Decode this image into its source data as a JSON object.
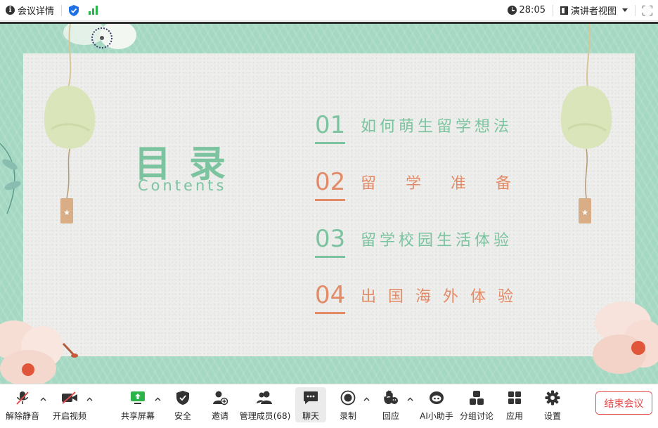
{
  "topbar": {
    "meeting_info": "会议详情",
    "timer": "28:05",
    "view_mode": "演讲者视图"
  },
  "slide": {
    "title": "目录",
    "subtitle": "Contents",
    "items": [
      {
        "num": "01",
        "text": "如何萌生留学想法",
        "color": "#7cc49f"
      },
      {
        "num": "02",
        "text": "留　学　准　备",
        "color": "#e38a66"
      },
      {
        "num": "03",
        "text": "留学校园生活体验",
        "color": "#7cc49f"
      },
      {
        "num": "04",
        "text": "出国海外体验",
        "color": "#e38a66"
      }
    ]
  },
  "toolbar": {
    "unmute": "解除静音",
    "start_video": "开启视频",
    "share_screen": "共享屏幕",
    "security": "安全",
    "invite": "邀请",
    "manage_members": "管理成员(68)",
    "chat": "聊天",
    "record": "录制",
    "reaction": "回应",
    "ai_assistant": "AI小助手",
    "breakout": "分组讨论",
    "apps": "应用",
    "settings": "设置",
    "end_meeting": "结束会议"
  },
  "colors": {
    "accent_green": "#7cc49f",
    "accent_orange": "#e38a66",
    "end_red": "#e24b4b",
    "signal_green": "#2bb44a",
    "shield_blue": "#1f6fe5"
  }
}
